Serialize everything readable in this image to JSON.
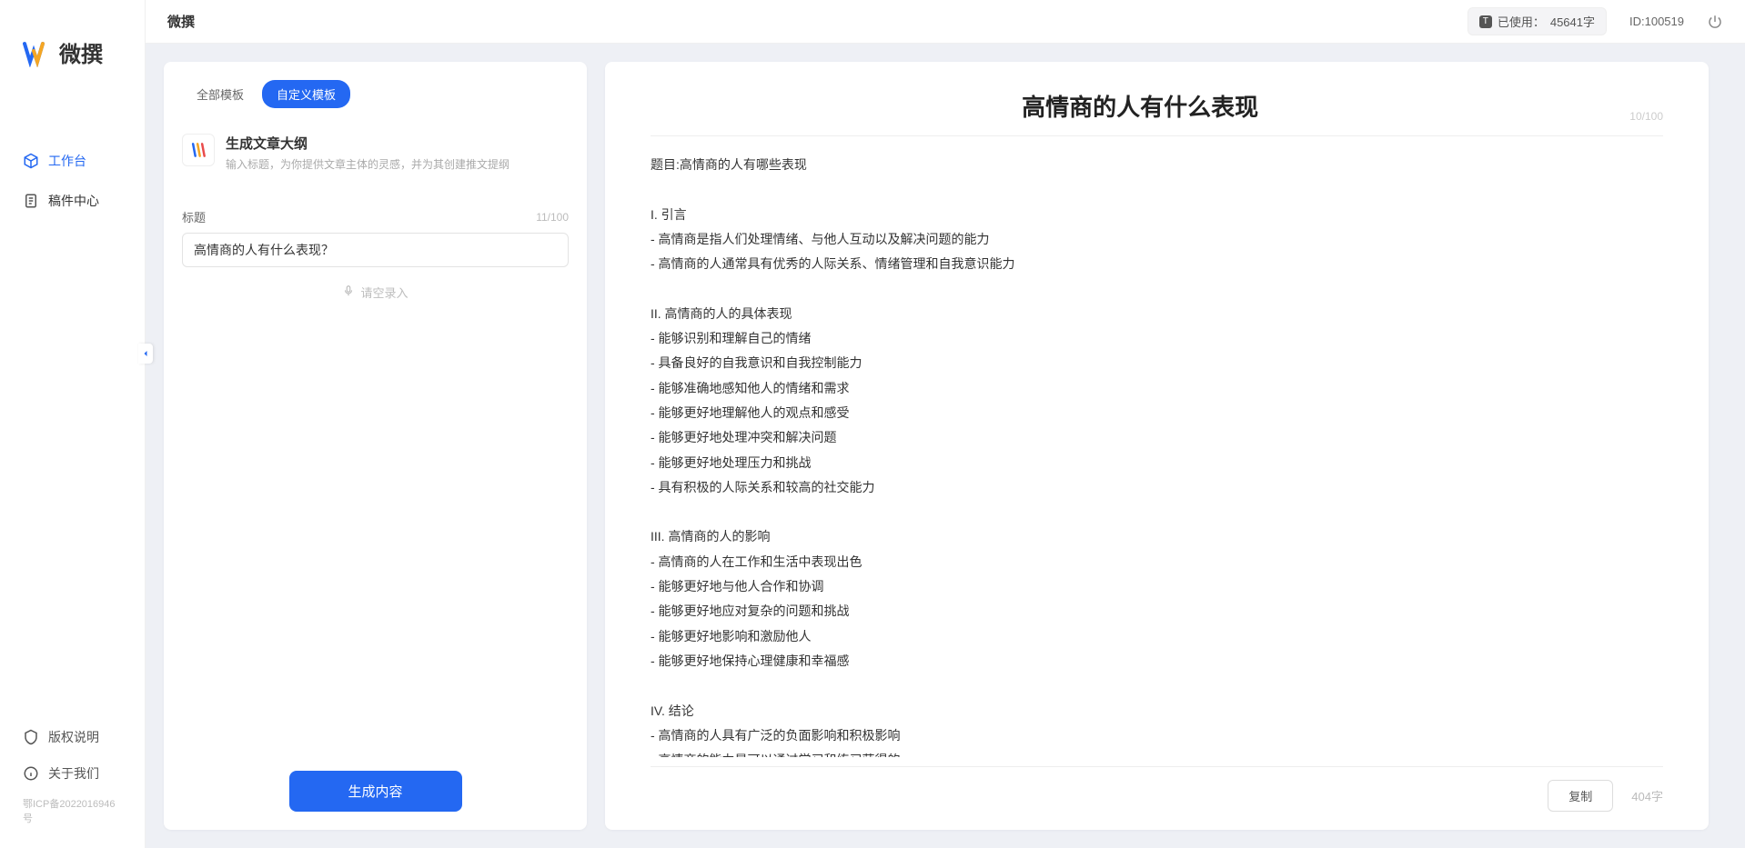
{
  "app": {
    "name": "微撰",
    "logo_text": "微撰"
  },
  "topbar": {
    "title": "微撰",
    "usage_prefix": "已使用：",
    "usage_value": "45641字",
    "user_id_label": "ID:100519"
  },
  "sidebar": {
    "nav": [
      {
        "label": "工作台",
        "icon": "cube",
        "active": true
      },
      {
        "label": "稿件中心",
        "icon": "doc",
        "active": false
      }
    ],
    "bottom": [
      {
        "label": "版权说明",
        "icon": "shield"
      },
      {
        "label": "关于我们",
        "icon": "info"
      }
    ],
    "icp": "鄂ICP备2022016946号"
  },
  "left_panel": {
    "tabs": [
      {
        "label": "全部模板",
        "active": false
      },
      {
        "label": "自定义模板",
        "active": true
      }
    ],
    "template": {
      "title": "生成文章大纲",
      "desc": "输入标题，为你提供文章主体的灵感，并为其创建推文提纲"
    },
    "field_label": "标题",
    "char_count": "11/100",
    "title_value": "高情商的人有什么表现？",
    "voice_hint": "请空录入",
    "generate_label": "生成内容"
  },
  "right_panel": {
    "title": "高情商的人有什么表现",
    "title_count": "10/100",
    "body": "题目:高情商的人有哪些表现\n\nI. 引言\n- 高情商是指人们处理情绪、与他人互动以及解决问题的能力\n- 高情商的人通常具有优秀的人际关系、情绪管理和自我意识能力\n\nII. 高情商的人的具体表现\n- 能够识别和理解自己的情绪\n- 具备良好的自我意识和自我控制能力\n- 能够准确地感知他人的情绪和需求\n- 能够更好地理解他人的观点和感受\n- 能够更好地处理冲突和解决问题\n- 能够更好地处理压力和挑战\n- 具有积极的人际关系和较高的社交能力\n\nIII. 高情商的人的影响\n- 高情商的人在工作和生活中表现出色\n- 能够更好地与他人合作和协调\n- 能够更好地应对复杂的问题和挑战\n- 能够更好地影响和激励他人\n- 能够更好地保持心理健康和幸福感\n\nIV. 结论\n- 高情商的人具有广泛的负面影响和积极影响\n- 高情商的能力是可以通过学习和练习获得的\n- 培养和提高高情商的能力对于个人的职业发展和生活质量至关重要。",
    "copy_label": "复制",
    "word_count": "404字"
  }
}
